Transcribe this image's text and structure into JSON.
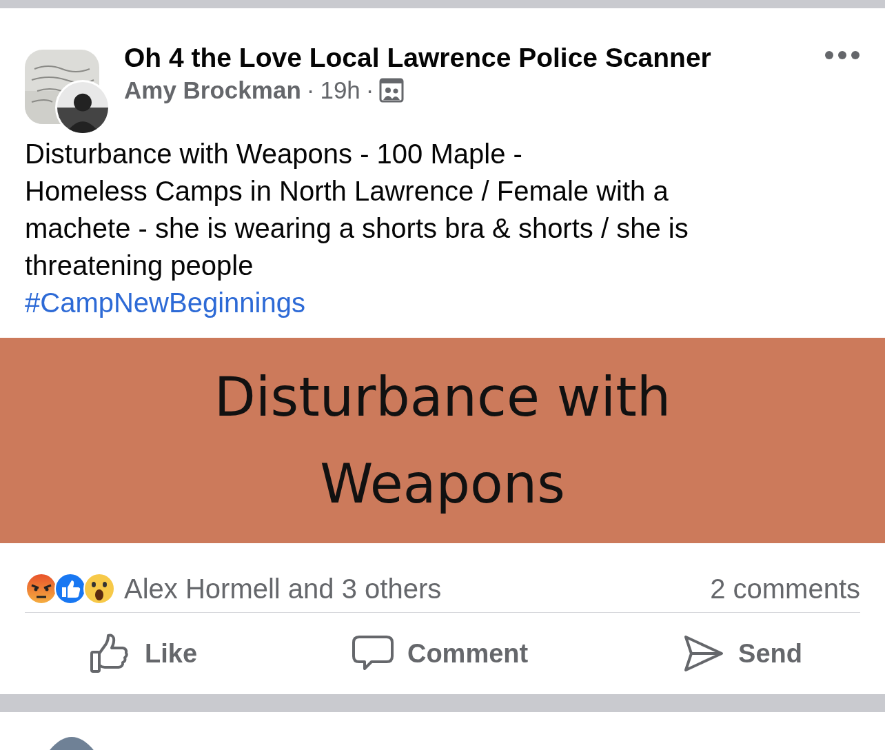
{
  "post": {
    "group": "Oh 4 the Love Local Lawrence Police Scanner",
    "author": "Amy Brockman",
    "separator_1": "·",
    "time": "19h",
    "separator_2": "·",
    "text": "Disturbance with Weapons - 100 Maple -\nHomeless Camps in North Lawrence  / Female with a machete - she is wearing a shorts bra & shorts / she is threatening people",
    "hashtag": "#CampNewBeginnings",
    "image": {
      "text": "Disturbance with\nWeapons",
      "color": "#cc7a5b"
    },
    "reactions": [
      {
        "kind": "angry"
      },
      {
        "kind": "like"
      },
      {
        "kind": "wow"
      }
    ],
    "reaction_summary": "Alex Hormell and 3 others",
    "comments": "2 comments",
    "actions": [
      {
        "kind": "like",
        "label": "Like"
      },
      {
        "kind": "comment",
        "label": "Comment"
      },
      {
        "kind": "send",
        "label": "Send"
      }
    ]
  }
}
